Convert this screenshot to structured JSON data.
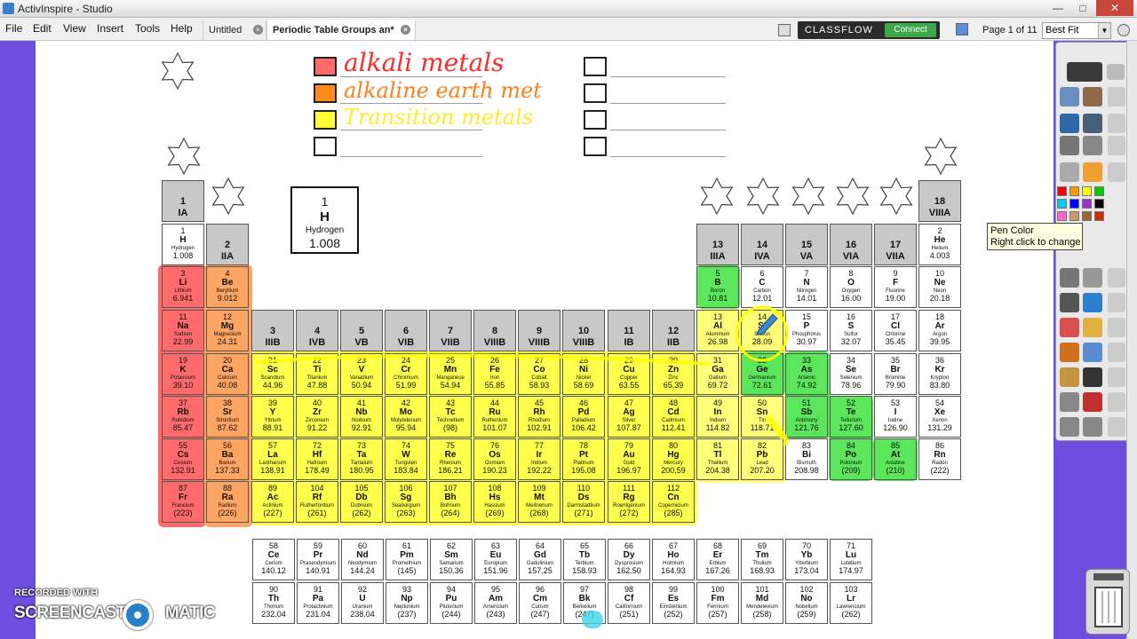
{
  "window": {
    "title": "ActivInspire - Studio",
    "minimize": "—",
    "maximize": "□",
    "close": "✕"
  },
  "menu": [
    "File",
    "Edit",
    "View",
    "Insert",
    "Tools",
    "Help"
  ],
  "tabs": [
    {
      "label": "Untitled",
      "active": false
    },
    {
      "label": "Periodic Table Groups an*",
      "active": true
    }
  ],
  "tab_close_glyph": "×",
  "classflow": {
    "label": "CLASSFLOW",
    "button": "Connect"
  },
  "page_indicator": "Page 1 of 11",
  "zoom": "Best Fit",
  "zoom_arrow": "▼",
  "tooltip": {
    "line1": "Pen Color",
    "line2": "Right click to change"
  },
  "watermark": {
    "top": "RECORDED WITH",
    "brand": "SCREENCAST",
    "brand2": "MATIC"
  },
  "legend": [
    {
      "label": "alkali metals",
      "color": "#ff2a2a",
      "fill": "#ff6b6b"
    },
    {
      "label": "alkaline earth met",
      "color": "#ff7f1a",
      "fill": "#ff8c1a"
    },
    {
      "label": "Transition metals",
      "color": "#ffe81a",
      "fill": "#ffff33"
    },
    {
      "label": "",
      "color": "#000000",
      "fill": "#ffffff"
    },
    {
      "label": "",
      "color": "#000000",
      "fill": "#ffffff"
    },
    {
      "label": "",
      "color": "#000000",
      "fill": "#ffffff"
    },
    {
      "label": "",
      "color": "#000000",
      "fill": "#ffffff"
    },
    {
      "label": "",
      "color": "#000000",
      "fill": "#ffffff"
    }
  ],
  "key_element": {
    "number": "1",
    "symbol": "H",
    "name": "Hydrogen",
    "mass": "1.008"
  },
  "group_headers": [
    {
      "num": "1",
      "label": "IA"
    },
    {
      "num": "2",
      "label": "IIA"
    },
    {
      "num": "3",
      "label": "IIIB"
    },
    {
      "num": "4",
      "label": "IVB"
    },
    {
      "num": "5",
      "label": "VB"
    },
    {
      "num": "6",
      "label": "VIB"
    },
    {
      "num": "7",
      "label": "VIIB"
    },
    {
      "num": "8",
      "label": "VIIIB"
    },
    {
      "num": "9",
      "label": "VIIIB"
    },
    {
      "num": "10",
      "label": "VIIIB"
    },
    {
      "num": "11",
      "label": "IB"
    },
    {
      "num": "12",
      "label": "IIB"
    },
    {
      "num": "13",
      "label": "IIIA"
    },
    {
      "num": "14",
      "label": "IVA"
    },
    {
      "num": "15",
      "label": "VA"
    },
    {
      "num": "16",
      "label": "VIA"
    },
    {
      "num": "17",
      "label": "VIIA"
    },
    {
      "num": "18",
      "label": "VIIIA"
    }
  ],
  "elements": [
    {
      "n": "1",
      "s": "H",
      "nm": "Hydrogen",
      "m": "1.008",
      "g": 1,
      "p": 1
    },
    {
      "n": "2",
      "s": "He",
      "nm": "Helium",
      "m": "4.003",
      "g": 18,
      "p": 1
    },
    {
      "n": "3",
      "s": "Li",
      "nm": "Lithium",
      "m": "6.941",
      "g": 1,
      "p": 2
    },
    {
      "n": "4",
      "s": "Be",
      "nm": "Beryllium",
      "m": "9.012",
      "g": 2,
      "p": 2
    },
    {
      "n": "5",
      "s": "B",
      "nm": "Boron",
      "m": "10.81",
      "g": 13,
      "p": 2
    },
    {
      "n": "6",
      "s": "C",
      "nm": "Carbon",
      "m": "12.01",
      "g": 14,
      "p": 2
    },
    {
      "n": "7",
      "s": "N",
      "nm": "Nitrogen",
      "m": "14.01",
      "g": 15,
      "p": 2
    },
    {
      "n": "8",
      "s": "O",
      "nm": "Oxygen",
      "m": "16.00",
      "g": 16,
      "p": 2
    },
    {
      "n": "9",
      "s": "F",
      "nm": "Fluorine",
      "m": "19.00",
      "g": 17,
      "p": 2
    },
    {
      "n": "10",
      "s": "Ne",
      "nm": "Neon",
      "m": "20.18",
      "g": 18,
      "p": 2
    },
    {
      "n": "11",
      "s": "Na",
      "nm": "Sodium",
      "m": "22.99",
      "g": 1,
      "p": 3
    },
    {
      "n": "12",
      "s": "Mg",
      "nm": "Magnesium",
      "m": "24.31",
      "g": 2,
      "p": 3
    },
    {
      "n": "13",
      "s": "Al",
      "nm": "Aluminum",
      "m": "26.98",
      "g": 13,
      "p": 3
    },
    {
      "n": "14",
      "s": "Si",
      "nm": "Silicon",
      "m": "28.09",
      "g": 14,
      "p": 3
    },
    {
      "n": "15",
      "s": "P",
      "nm": "Phosphorus",
      "m": "30.97",
      "g": 15,
      "p": 3
    },
    {
      "n": "16",
      "s": "S",
      "nm": "Sulfur",
      "m": "32.07",
      "g": 16,
      "p": 3
    },
    {
      "n": "17",
      "s": "Cl",
      "nm": "Chlorine",
      "m": "35.45",
      "g": 17,
      "p": 3
    },
    {
      "n": "18",
      "s": "Ar",
      "nm": "Argon",
      "m": "39.95",
      "g": 18,
      "p": 3
    },
    {
      "n": "19",
      "s": "K",
      "nm": "Potassium",
      "m": "39.10",
      "g": 1,
      "p": 4
    },
    {
      "n": "20",
      "s": "Ca",
      "nm": "Calcium",
      "m": "40.08",
      "g": 2,
      "p": 4
    },
    {
      "n": "21",
      "s": "Sc",
      "nm": "Scandium",
      "m": "44.96",
      "g": 3,
      "p": 4
    },
    {
      "n": "22",
      "s": "Ti",
      "nm": "Titanium",
      "m": "47.88",
      "g": 4,
      "p": 4
    },
    {
      "n": "23",
      "s": "V",
      "nm": "Vanadium",
      "m": "50.94",
      "g": 5,
      "p": 4
    },
    {
      "n": "24",
      "s": "Cr",
      "nm": "Chromium",
      "m": "51.99",
      "g": 6,
      "p": 4
    },
    {
      "n": "25",
      "s": "Mn",
      "nm": "Manganese",
      "m": "54.94",
      "g": 7,
      "p": 4
    },
    {
      "n": "26",
      "s": "Fe",
      "nm": "Iron",
      "m": "55.85",
      "g": 8,
      "p": 4
    },
    {
      "n": "27",
      "s": "Co",
      "nm": "Cobalt",
      "m": "58.93",
      "g": 9,
      "p": 4
    },
    {
      "n": "28",
      "s": "Ni",
      "nm": "Nickel",
      "m": "58.69",
      "g": 10,
      "p": 4
    },
    {
      "n": "29",
      "s": "Cu",
      "nm": "Copper",
      "m": "63.55",
      "g": 11,
      "p": 4
    },
    {
      "n": "30",
      "s": "Zn",
      "nm": "Zinc",
      "m": "65.39",
      "g": 12,
      "p": 4
    },
    {
      "n": "31",
      "s": "Ga",
      "nm": "Gallium",
      "m": "69.72",
      "g": 13,
      "p": 4
    },
    {
      "n": "32",
      "s": "Ge",
      "nm": "Germanium",
      "m": "72.61",
      "g": 14,
      "p": 4
    },
    {
      "n": "33",
      "s": "As",
      "nm": "Arsenic",
      "m": "74.92",
      "g": 15,
      "p": 4
    },
    {
      "n": "34",
      "s": "Se",
      "nm": "Selenium",
      "m": "78.96",
      "g": 16,
      "p": 4
    },
    {
      "n": "35",
      "s": "Br",
      "nm": "Bromine",
      "m": "79.90",
      "g": 17,
      "p": 4
    },
    {
      "n": "36",
      "s": "Kr",
      "nm": "Krypton",
      "m": "83.80",
      "g": 18,
      "p": 4
    },
    {
      "n": "37",
      "s": "Rb",
      "nm": "Rubidium",
      "m": "85.47",
      "g": 1,
      "p": 5
    },
    {
      "n": "38",
      "s": "Sr",
      "nm": "Strontium",
      "m": "87.62",
      "g": 2,
      "p": 5
    },
    {
      "n": "39",
      "s": "Y",
      "nm": "Yttrium",
      "m": "88.91",
      "g": 3,
      "p": 5
    },
    {
      "n": "40",
      "s": "Zr",
      "nm": "Zirconium",
      "m": "91.22",
      "g": 4,
      "p": 5
    },
    {
      "n": "41",
      "s": "Nb",
      "nm": "Niobium",
      "m": "92.91",
      "g": 5,
      "p": 5
    },
    {
      "n": "42",
      "s": "Mo",
      "nm": "Molybdenum",
      "m": "95.94",
      "g": 6,
      "p": 5
    },
    {
      "n": "43",
      "s": "Tc",
      "nm": "Technetium",
      "m": "(98)",
      "g": 7,
      "p": 5
    },
    {
      "n": "44",
      "s": "Ru",
      "nm": "Ruthenium",
      "m": "101.07",
      "g": 8,
      "p": 5
    },
    {
      "n": "45",
      "s": "Rh",
      "nm": "Rhodium",
      "m": "102.91",
      "g": 9,
      "p": 5
    },
    {
      "n": "46",
      "s": "Pd",
      "nm": "Palladium",
      "m": "106.42",
      "g": 10,
      "p": 5
    },
    {
      "n": "47",
      "s": "Ag",
      "nm": "Silver",
      "m": "107.87",
      "g": 11,
      "p": 5
    },
    {
      "n": "48",
      "s": "Cd",
      "nm": "Cadmium",
      "m": "112.41",
      "g": 12,
      "p": 5
    },
    {
      "n": "49",
      "s": "In",
      "nm": "Indium",
      "m": "114.82",
      "g": 13,
      "p": 5
    },
    {
      "n": "50",
      "s": "Sn",
      "nm": "Tin",
      "m": "118.71",
      "g": 14,
      "p": 5
    },
    {
      "n": "51",
      "s": "Sb",
      "nm": "Antimony",
      "m": "121.76",
      "g": 15,
      "p": 5
    },
    {
      "n": "52",
      "s": "Te",
      "nm": "Tellurium",
      "m": "127.60",
      "g": 16,
      "p": 5
    },
    {
      "n": "53",
      "s": "I",
      "nm": "Iodine",
      "m": "126.90",
      "g": 17,
      "p": 5
    },
    {
      "n": "54",
      "s": "Xe",
      "nm": "Xenon",
      "m": "131.29",
      "g": 18,
      "p": 5
    },
    {
      "n": "55",
      "s": "Cs",
      "nm": "Cesium",
      "m": "132.91",
      "g": 1,
      "p": 6
    },
    {
      "n": "56",
      "s": "Ba",
      "nm": "Barium",
      "m": "137.33",
      "g": 2,
      "p": 6
    },
    {
      "n": "57",
      "s": "La",
      "nm": "Lanthanum",
      "m": "138.91",
      "g": 3,
      "p": 6
    },
    {
      "n": "72",
      "s": "Hf",
      "nm": "Hafnium",
      "m": "178.49",
      "g": 4,
      "p": 6
    },
    {
      "n": "73",
      "s": "Ta",
      "nm": "Tantalum",
      "m": "180.95",
      "g": 5,
      "p": 6
    },
    {
      "n": "74",
      "s": "W",
      "nm": "Tungsten",
      "m": "183.84",
      "g": 6,
      "p": 6
    },
    {
      "n": "75",
      "s": "Re",
      "nm": "Rhenium",
      "m": "186.21",
      "g": 7,
      "p": 6
    },
    {
      "n": "76",
      "s": "Os",
      "nm": "Osmium",
      "m": "190.23",
      "g": 8,
      "p": 6
    },
    {
      "n": "77",
      "s": "Ir",
      "nm": "Iridium",
      "m": "192.22",
      "g": 9,
      "p": 6
    },
    {
      "n": "78",
      "s": "Pt",
      "nm": "Platinum",
      "m": "195.08",
      "g": 10,
      "p": 6
    },
    {
      "n": "79",
      "s": "Au",
      "nm": "Gold",
      "m": "196.97",
      "g": 11,
      "p": 6
    },
    {
      "n": "80",
      "s": "Hg",
      "nm": "Mercury",
      "m": "200.59",
      "g": 12,
      "p": 6
    },
    {
      "n": "81",
      "s": "Tl",
      "nm": "Thallium",
      "m": "204.38",
      "g": 13,
      "p": 6
    },
    {
      "n": "82",
      "s": "Pb",
      "nm": "Lead",
      "m": "207.20",
      "g": 14,
      "p": 6
    },
    {
      "n": "83",
      "s": "Bi",
      "nm": "Bismuth",
      "m": "208.98",
      "g": 15,
      "p": 6
    },
    {
      "n": "84",
      "s": "Po",
      "nm": "Polonium",
      "m": "(209)",
      "g": 16,
      "p": 6
    },
    {
      "n": "85",
      "s": "At",
      "nm": "Astatine",
      "m": "(210)",
      "g": 17,
      "p": 6
    },
    {
      "n": "86",
      "s": "Rn",
      "nm": "Radon",
      "m": "(222)",
      "g": 18,
      "p": 6
    },
    {
      "n": "87",
      "s": "Fr",
      "nm": "Francium",
      "m": "(223)",
      "g": 1,
      "p": 7
    },
    {
      "n": "88",
      "s": "Ra",
      "nm": "Radium",
      "m": "(226)",
      "g": 2,
      "p": 7
    },
    {
      "n": "89",
      "s": "Ac",
      "nm": "Actinium",
      "m": "(227)",
      "g": 3,
      "p": 7
    },
    {
      "n": "104",
      "s": "Rf",
      "nm": "Rutherfordium",
      "m": "(261)",
      "g": 4,
      "p": 7
    },
    {
      "n": "105",
      "s": "Db",
      "nm": "Dubnium",
      "m": "(262)",
      "g": 5,
      "p": 7
    },
    {
      "n": "106",
      "s": "Sg",
      "nm": "Seaborgium",
      "m": "(263)",
      "g": 6,
      "p": 7
    },
    {
      "n": "107",
      "s": "Bh",
      "nm": "Bohrium",
      "m": "(264)",
      "g": 7,
      "p": 7
    },
    {
      "n": "108",
      "s": "Hs",
      "nm": "Hassium",
      "m": "(269)",
      "g": 8,
      "p": 7
    },
    {
      "n": "109",
      "s": "Mt",
      "nm": "Meitnerium",
      "m": "(268)",
      "g": 9,
      "p": 7
    },
    {
      "n": "110",
      "s": "Ds",
      "nm": "Darmstadtium",
      "m": "(271)",
      "g": 10,
      "p": 7
    },
    {
      "n": "111",
      "s": "Rg",
      "nm": "Roentgenium",
      "m": "(272)",
      "g": 11,
      "p": 7
    },
    {
      "n": "112",
      "s": "Cn",
      "nm": "Copernicium",
      "m": "(285)",
      "g": 12,
      "p": 7
    }
  ],
  "lanthanides": [
    {
      "n": "58",
      "s": "Ce",
      "nm": "Cerium",
      "m": "140.12"
    },
    {
      "n": "59",
      "s": "Pr",
      "nm": "Praseodymium",
      "m": "140.91"
    },
    {
      "n": "60",
      "s": "Nd",
      "nm": "Neodymium",
      "m": "144.24"
    },
    {
      "n": "61",
      "s": "Pm",
      "nm": "Promethium",
      "m": "(145)"
    },
    {
      "n": "62",
      "s": "Sm",
      "nm": "Samarium",
      "m": "150.36"
    },
    {
      "n": "63",
      "s": "Eu",
      "nm": "Europium",
      "m": "151.96"
    },
    {
      "n": "64",
      "s": "Gd",
      "nm": "Gadolinium",
      "m": "157.25"
    },
    {
      "n": "65",
      "s": "Tb",
      "nm": "Terbium",
      "m": "158.93"
    },
    {
      "n": "66",
      "s": "Dy",
      "nm": "Dysprosium",
      "m": "162.50"
    },
    {
      "n": "67",
      "s": "Ho",
      "nm": "Holmium",
      "m": "164.93"
    },
    {
      "n": "68",
      "s": "Er",
      "nm": "Erbium",
      "m": "167.26"
    },
    {
      "n": "69",
      "s": "Tm",
      "nm": "Thulium",
      "m": "168.93"
    },
    {
      "n": "70",
      "s": "Yb",
      "nm": "Ytterbium",
      "m": "173.04"
    },
    {
      "n": "71",
      "s": "Lu",
      "nm": "Lutetium",
      "m": "174.97"
    }
  ],
  "actinides": [
    {
      "n": "90",
      "s": "Th",
      "nm": "Thorium",
      "m": "232.04"
    },
    {
      "n": "91",
      "s": "Pa",
      "nm": "Protactinium",
      "m": "231.04"
    },
    {
      "n": "92",
      "s": "U",
      "nm": "Uranium",
      "m": "238.04"
    },
    {
      "n": "93",
      "s": "Np",
      "nm": "Neptunium",
      "m": "(237)"
    },
    {
      "n": "94",
      "s": "Pu",
      "nm": "Plutonium",
      "m": "(244)"
    },
    {
      "n": "95",
      "s": "Am",
      "nm": "Americium",
      "m": "(243)"
    },
    {
      "n": "96",
      "s": "Cm",
      "nm": "Curium",
      "m": "(247)"
    },
    {
      "n": "97",
      "s": "Bk",
      "nm": "Berkelium",
      "m": "(247)"
    },
    {
      "n": "98",
      "s": "Cf",
      "nm": "Californium",
      "m": "(251)"
    },
    {
      "n": "99",
      "s": "Es",
      "nm": "Einsteinium",
      "m": "(252)"
    },
    {
      "n": "100",
      "s": "Fm",
      "nm": "Fermium",
      "m": "(257)"
    },
    {
      "n": "101",
      "s": "Md",
      "nm": "Mendelevium",
      "m": "(258)"
    },
    {
      "n": "102",
      "s": "No",
      "nm": "Nobelium",
      "m": "(259)"
    },
    {
      "n": "103",
      "s": "Lr",
      "nm": "Lawrencium",
      "m": "(262)"
    }
  ],
  "colors": {
    "canvas_bg": "#6d4fe0",
    "alkali": "#ff6b6b",
    "alkaline_earth": "#ffa564",
    "transition": "#ffff4d",
    "metalloid": "#5ce65c",
    "header_gray": "#c8c8c8"
  },
  "pen_colors": [
    "#ff0000",
    "#ff9900",
    "#ffff00",
    "#00cc00",
    "#00ccff",
    "#0000ff",
    "#9933cc",
    "#000000",
    "#ff66cc",
    "#cc9966",
    "#996633",
    "#cc3300"
  ]
}
